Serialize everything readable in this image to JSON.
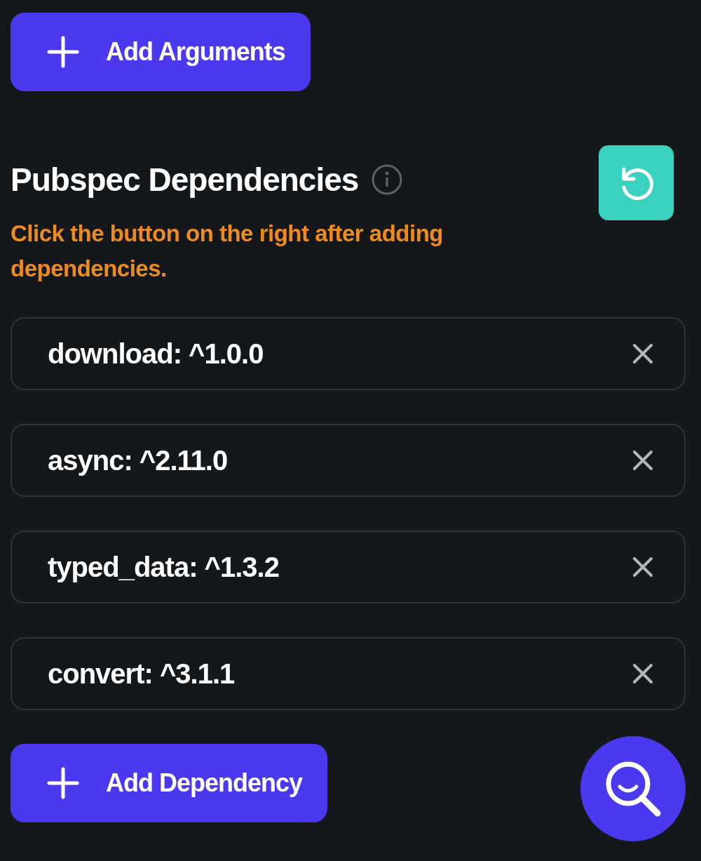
{
  "add_arguments_button": {
    "label": "Add Arguments"
  },
  "section": {
    "title": "Pubspec Dependencies",
    "hint": "Click the button on the right after adding dependencies."
  },
  "dependencies": [
    {
      "label": "download: ^1.0.0"
    },
    {
      "label": "async: ^2.11.0"
    },
    {
      "label": "typed_data: ^1.3.2"
    },
    {
      "label": "convert: ^3.1.1"
    }
  ],
  "add_dependency_button": {
    "label": "Add Dependency"
  }
}
